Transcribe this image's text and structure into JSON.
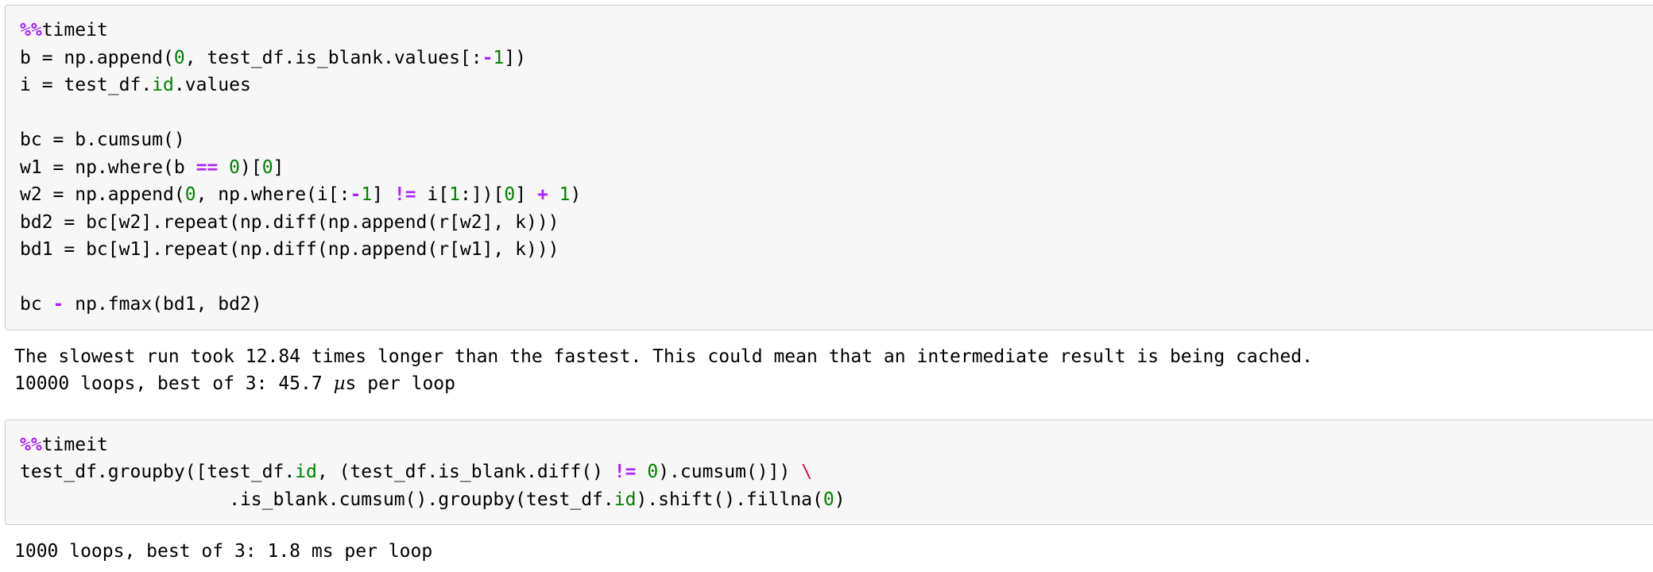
{
  "notebook": {
    "cells": [
      {
        "type": "code",
        "name": "timeit-cell-numpy",
        "lines": [
          [
            {
              "t": "%%",
              "c": "magic"
            },
            {
              "t": "timeit",
              "c": "magicname"
            }
          ],
          [
            {
              "t": "b = np.append(",
              "c": "plain"
            },
            {
              "t": "0",
              "c": "num"
            },
            {
              "t": ", test_df.is_blank.values[:",
              "c": "plain"
            },
            {
              "t": "-",
              "c": "op"
            },
            {
              "t": "1",
              "c": "num"
            },
            {
              "t": "])",
              "c": "plain"
            }
          ],
          [
            {
              "t": "i = test_df.",
              "c": "plain"
            },
            {
              "t": "id",
              "c": "builtin"
            },
            {
              "t": ".values",
              "c": "plain"
            }
          ],
          [],
          [
            {
              "t": "bc = b.cumsum()",
              "c": "plain"
            }
          ],
          [
            {
              "t": "w1 = np.where(b ",
              "c": "plain"
            },
            {
              "t": "==",
              "c": "op"
            },
            {
              "t": " ",
              "c": "plain"
            },
            {
              "t": "0",
              "c": "num"
            },
            {
              "t": ")[",
              "c": "plain"
            },
            {
              "t": "0",
              "c": "num"
            },
            {
              "t": "]",
              "c": "plain"
            }
          ],
          [
            {
              "t": "w2 = np.append(",
              "c": "plain"
            },
            {
              "t": "0",
              "c": "num"
            },
            {
              "t": ", np.where(i[:",
              "c": "plain"
            },
            {
              "t": "-",
              "c": "op"
            },
            {
              "t": "1",
              "c": "num"
            },
            {
              "t": "] ",
              "c": "plain"
            },
            {
              "t": "!=",
              "c": "op"
            },
            {
              "t": " i[",
              "c": "plain"
            },
            {
              "t": "1",
              "c": "num"
            },
            {
              "t": ":])[",
              "c": "plain"
            },
            {
              "t": "0",
              "c": "num"
            },
            {
              "t": "] ",
              "c": "plain"
            },
            {
              "t": "+",
              "c": "op"
            },
            {
              "t": " ",
              "c": "plain"
            },
            {
              "t": "1",
              "c": "num"
            },
            {
              "t": ")",
              "c": "plain"
            }
          ],
          [
            {
              "t": "bd2 = bc[w2].repeat(np.diff(np.append(r[w2], k)))",
              "c": "plain"
            }
          ],
          [
            {
              "t": "bd1 = bc[w1].repeat(np.diff(np.append(r[w1], k)))",
              "c": "plain"
            }
          ],
          [],
          [
            {
              "t": "bc ",
              "c": "plain"
            },
            {
              "t": "-",
              "c": "op"
            },
            {
              "t": " np.fmax(bd1, bd2)",
              "c": "plain"
            }
          ]
        ],
        "output": [
          "The slowest run took 12.84 times longer than the fastest. This could mean that an intermediate result is being cached.",
          "10000 loops, best of 3: 45.7 µs per loop"
        ]
      },
      {
        "type": "code",
        "name": "timeit-cell-pandas",
        "lines": [
          [
            {
              "t": "%%",
              "c": "magic"
            },
            {
              "t": "timeit",
              "c": "magicname"
            }
          ],
          [
            {
              "t": "test_df.groupby([test_df.",
              "c": "plain"
            },
            {
              "t": "id",
              "c": "builtin"
            },
            {
              "t": ", (test_df.is_blank.diff() ",
              "c": "plain"
            },
            {
              "t": "!=",
              "c": "op"
            },
            {
              "t": " ",
              "c": "plain"
            },
            {
              "t": "0",
              "c": "num"
            },
            {
              "t": ").cumsum()]) ",
              "c": "plain"
            },
            {
              "t": "\\",
              "c": "esc"
            }
          ],
          [
            {
              "t": "                   .is_blank.cumsum().groupby(test_df.",
              "c": "plain"
            },
            {
              "t": "id",
              "c": "builtin"
            },
            {
              "t": ").shift().fillna(",
              "c": "plain"
            },
            {
              "t": "0",
              "c": "num"
            },
            {
              "t": ")",
              "c": "plain"
            }
          ]
        ],
        "output": [
          "1000 loops, best of 3: 1.8 ms per loop"
        ]
      }
    ]
  },
  "theme": {
    "cell_background": "#f7f7f7",
    "cell_border": "#cfcfcf",
    "page_background": "#ffffff",
    "text_color": "#000000",
    "magic_color": "#aa22ff",
    "number_color": "#008000",
    "operator_color": "#aa22ff",
    "builtin_color": "#008000",
    "escape_color": "#dd1144"
  }
}
